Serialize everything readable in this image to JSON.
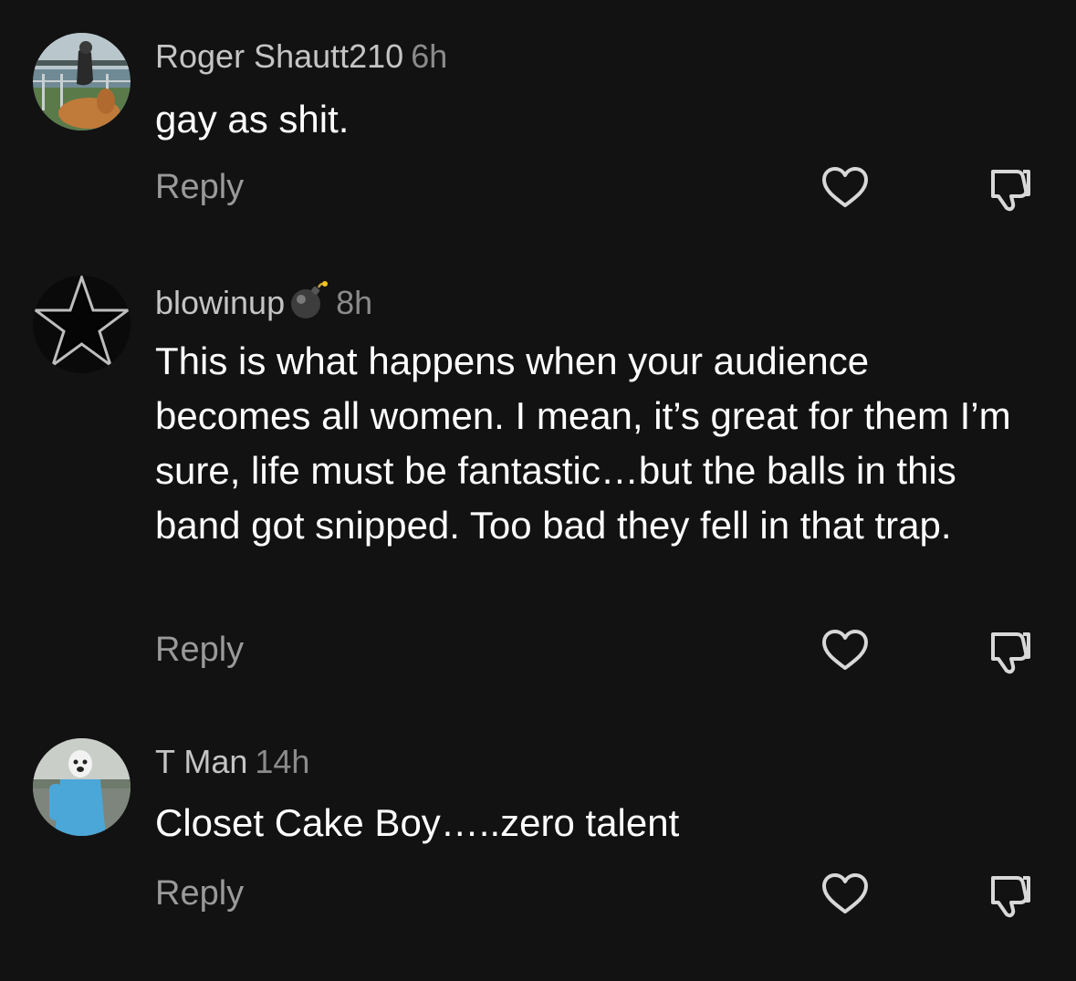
{
  "comments": [
    {
      "username": "Roger Shautt210",
      "time": "6h",
      "text": "gay as shit.",
      "reply_label": "Reply",
      "avatar_icon": "user-photo-rider"
    },
    {
      "username": "blowinup",
      "username_emoji": "bomb-icon",
      "time": "8h",
      "text": "This is what happens when your audience becomes all women. I mean, it’s great for them I’m sure, life must be fantastic…but the balls in this band got snipped. Too bad they fell in that trap.",
      "reply_label": "Reply",
      "avatar_icon": "star-logo"
    },
    {
      "username": "T Man",
      "time": "14h",
      "text": "Closet Cake Boy…..zero talent",
      "reply_label": "Reply",
      "avatar_icon": "user-photo-figure"
    }
  ],
  "icons": {
    "like": "heart-outline-icon",
    "dislike": "thumbs-down-outline-icon"
  },
  "colors": {
    "background": "#121212",
    "username": "#c4c4c4",
    "timestamp": "#8b8b8b",
    "text": "#ffffff",
    "reply": "#9a9a9a",
    "icon": "#d8d8d8"
  }
}
